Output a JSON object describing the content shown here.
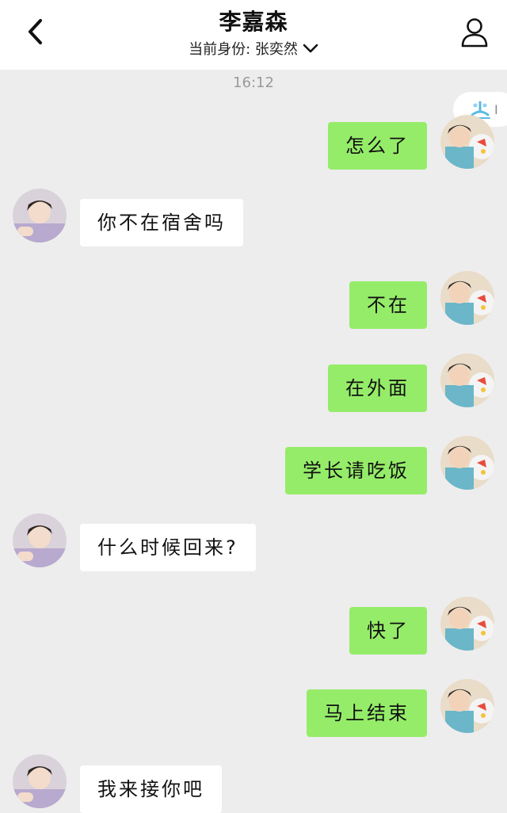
{
  "header": {
    "title": "李嘉森",
    "identity_label": "当前身份: 张奕然"
  },
  "timestamp": "16:12",
  "edge_badge": {
    "text": "I"
  },
  "messages": [
    {
      "side": "out",
      "text": "怎么了"
    },
    {
      "side": "in",
      "text": "你不在宿舍吗"
    },
    {
      "side": "out",
      "text": "不在"
    },
    {
      "side": "out",
      "text": "在外面"
    },
    {
      "side": "out",
      "text": "学长请吃饭"
    },
    {
      "side": "in",
      "text": "什么时候回来?"
    },
    {
      "side": "out",
      "text": "快了"
    },
    {
      "side": "out",
      "text": "马上结束"
    },
    {
      "side": "in",
      "text": "我来接你吧"
    }
  ],
  "colors": {
    "outgoing_bubble": "#95ec69",
    "incoming_bubble": "#ffffff",
    "background": "#ededed"
  },
  "icons": {
    "back": "chevron-left-icon",
    "profile": "person-icon",
    "dropdown": "chevron-down-icon"
  }
}
